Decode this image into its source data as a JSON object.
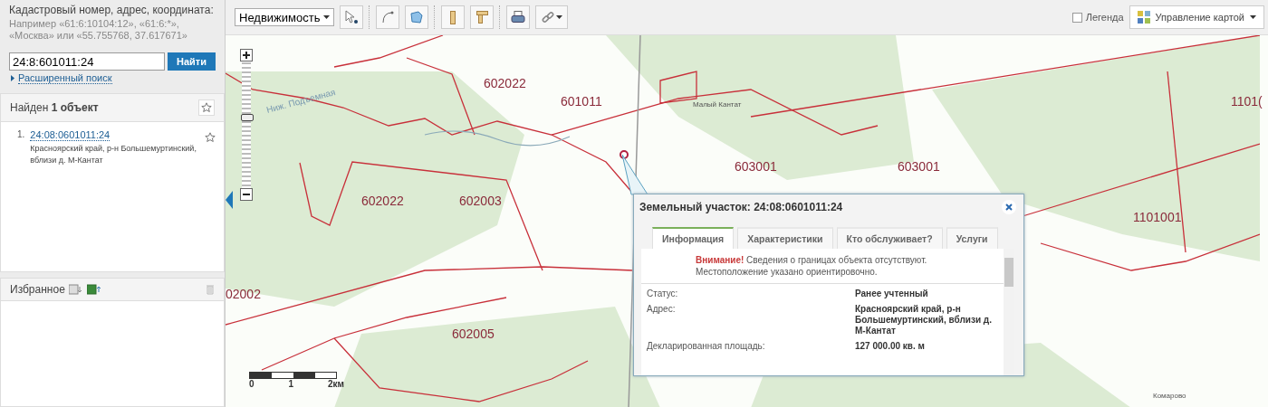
{
  "search": {
    "label": "Кадастровый номер, адрес, координата:",
    "hint": "Например «61:6:10104:12», «61:6:*», «Москва» или «55.755768, 37.617671»",
    "value": "24:8:601011:24",
    "button": "Найти",
    "advanced_link": "Расширенный поиск"
  },
  "results": {
    "title": "Найден **1 объект**",
    "items": [
      {
        "index": "1.",
        "number": "24:08:0601011:24",
        "address": "Красноярский край, р-н Большемуртинский, вблизи д. М-Кантат"
      }
    ]
  },
  "favorites": {
    "title": "Избранное"
  },
  "toolbar": {
    "dropdown": "Недвижимость",
    "legend": {
      "label": "Легенда",
      "checked": false
    },
    "map_control": "Управление картой"
  },
  "map": {
    "zoom": {
      "level": 0.57
    },
    "labels": [
      {
        "text": "602022",
        "kind": "parcel"
      },
      {
        "text": "601011",
        "kind": "parcel"
      },
      {
        "text": "602022",
        "kind": "parcel"
      },
      {
        "text": "602003",
        "kind": "parcel"
      },
      {
        "text": "603001",
        "kind": "parcel"
      },
      {
        "text": "603001",
        "kind": "parcel"
      },
      {
        "text": "1101001",
        "kind": "parcel"
      },
      {
        "text": "1101(",
        "kind": "parcel"
      },
      {
        "text": "02002",
        "kind": "parcel"
      },
      {
        "text": "602005",
        "kind": "parcel"
      },
      {
        "text": "Малый Кантат",
        "kind": "place"
      },
      {
        "text": "Комарово",
        "kind": "place"
      },
      {
        "text": "Ниж. Подъемная",
        "kind": "river"
      }
    ],
    "scale": [
      "0",
      "1",
      "2км"
    ]
  },
  "popup": {
    "title": "Земельный участок: 24:08:0601011:24",
    "tabs": [
      {
        "label": "Информация",
        "selected": true
      },
      {
        "label": "Характеристики",
        "selected": false
      },
      {
        "label": "Кто обслуживает?",
        "selected": false
      },
      {
        "label": "Услуги",
        "selected": false
      }
    ],
    "warning": "**Внимание!** Сведения о границах объекта отсутствуют. Местоположение указано ориентировочно.",
    "fields": [
      {
        "label": "Статус:",
        "value": "Ранее учтенный"
      },
      {
        "label": "Адрес:",
        "value": "Красноярский край, р-н Большемуртинский, вблизи д. М-Кантат"
      },
      {
        "label": "Декларированная площадь:",
        "value": "127 000.00 кв. м"
      }
    ]
  }
}
